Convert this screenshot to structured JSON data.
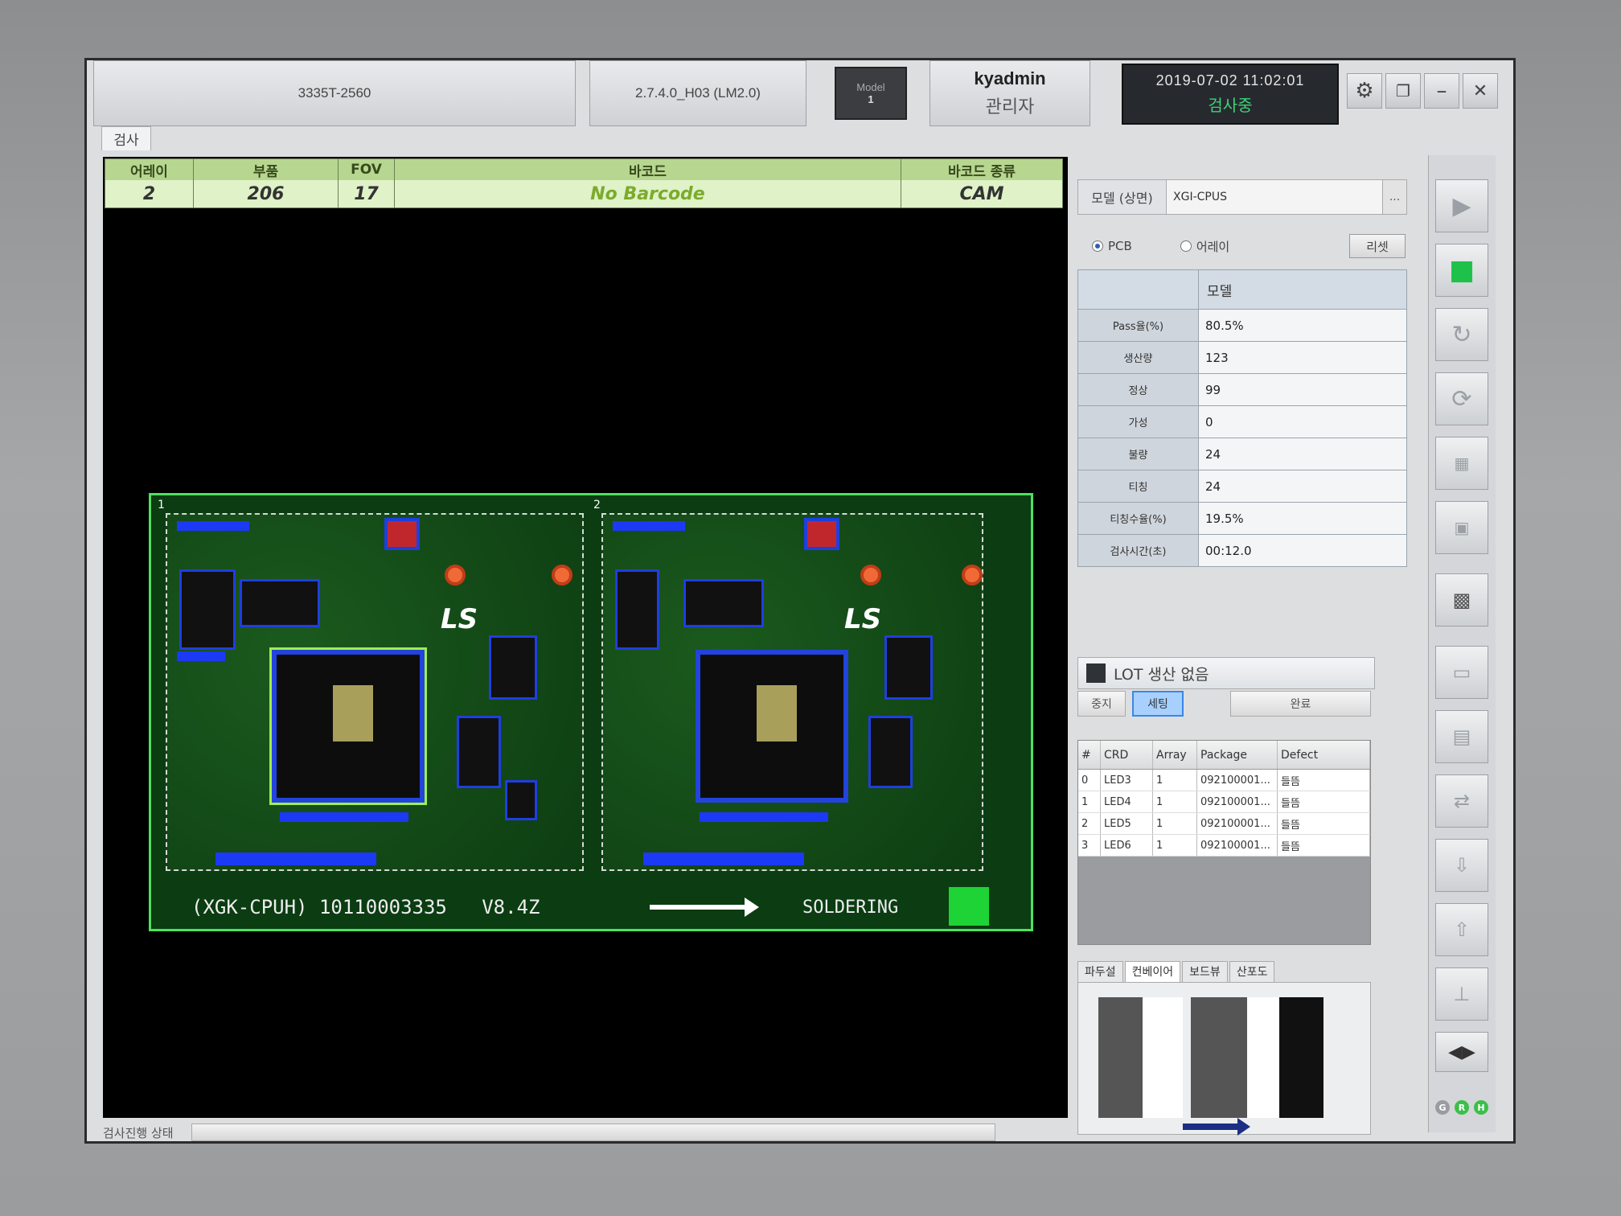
{
  "titlebar": {
    "model_code": "3335T-2560",
    "version": "2.7.4.0_H03 (LM2.0)",
    "model_button": {
      "label": "Model",
      "number": "1"
    },
    "user_name": "kyadmin",
    "user_role": "관리자",
    "datetime": "2019-07-02 11:02:01",
    "status": "검사중",
    "window_buttons": [
      "gear-icon",
      "restore-icon",
      "minimize-icon",
      "close-icon"
    ]
  },
  "tab": "검사",
  "info": {
    "headers": [
      "어레이",
      "부품",
      "FOV",
      "바코드",
      "바코드 종류"
    ],
    "values": [
      "2",
      "206",
      "17",
      "No Barcode",
      "CAM"
    ]
  },
  "pcb": {
    "board_numbers": [
      "1",
      "2"
    ],
    "footer_text": "(XGK-CPUH) 10110003335   V8.4Z",
    "soldering": "SOLDERING"
  },
  "progress_label": "검사진행 상태",
  "model_field": {
    "label": "모델 (상면)",
    "value": "XGI-CPUS",
    "more": "..."
  },
  "radio": {
    "pcb": "PCB",
    "array": "어레이",
    "reset": "리셋"
  },
  "stats": {
    "header": "모델",
    "rows": [
      {
        "key": "Pass율(%)",
        "value": "80.5%"
      },
      {
        "key": "생산량",
        "value": "123"
      },
      {
        "key": "정상",
        "value": "99"
      },
      {
        "key": "가성",
        "value": "0"
      },
      {
        "key": "불량",
        "value": "24"
      },
      {
        "key": "티칭",
        "value": "24"
      },
      {
        "key": "티칭수율(%)",
        "value": "19.5%"
      },
      {
        "key": "검사시간(초)",
        "value": "00:12.0"
      }
    ]
  },
  "lot": {
    "label": "LOT 생산 없음",
    "buttons": [
      "중지",
      "세팅",
      "완료"
    ]
  },
  "defects": {
    "headers": [
      "#",
      "CRD",
      "Array",
      "Package",
      "Defect"
    ],
    "rows": [
      [
        "0",
        "LED3",
        "1",
        "092100001...",
        "들뜸"
      ],
      [
        "1",
        "LED4",
        "1",
        "092100001...",
        "들뜸"
      ],
      [
        "2",
        "LED5",
        "1",
        "092100001...",
        "들뜸"
      ],
      [
        "3",
        "LED6",
        "1",
        "092100001...",
        "들뜸"
      ]
    ]
  },
  "bottom_tabs": [
    "파두설",
    "컨베이어",
    "보드뷰",
    "산포도"
  ],
  "indicators": [
    "G",
    "R",
    "H"
  ],
  "colors": {
    "pcb_green": "#0b3c12",
    "outline": "#4fe060",
    "status_green": "#3fd37a",
    "component_blue": "#1c39f5"
  }
}
